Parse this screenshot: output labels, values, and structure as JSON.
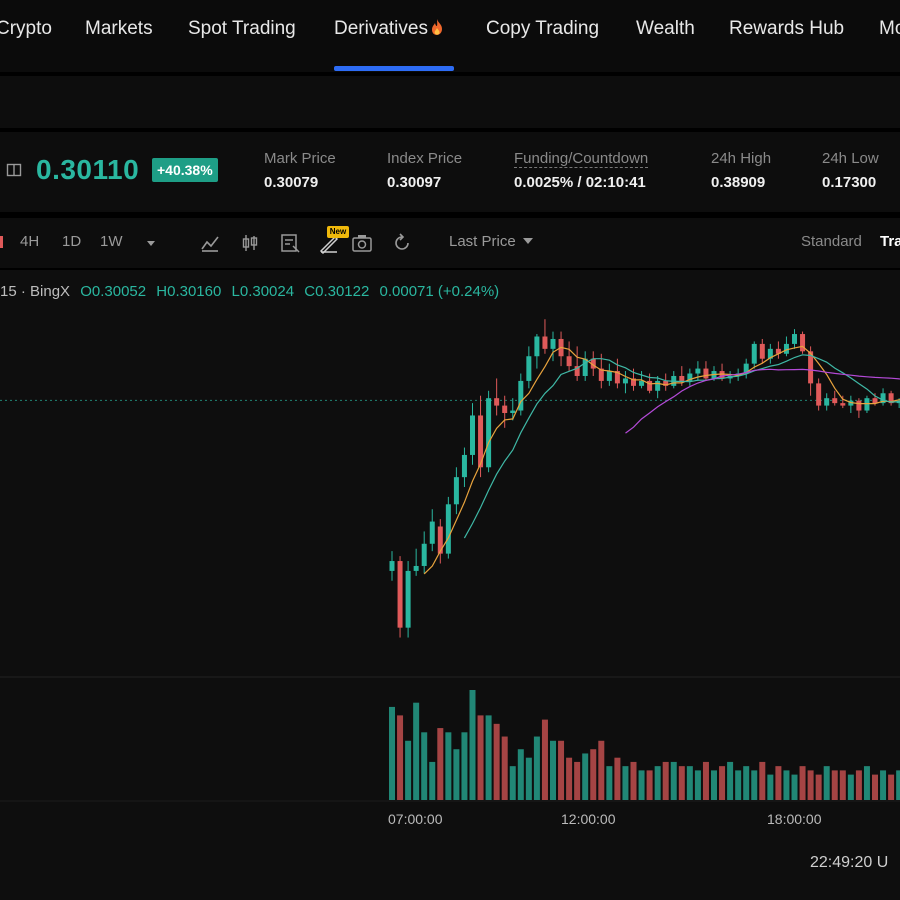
{
  "nav": {
    "items": [
      "Crypto",
      "Markets",
      "Spot Trading",
      "Derivatives",
      "Copy Trading",
      "Wealth",
      "Rewards Hub",
      "Mo"
    ],
    "active": "Derivatives"
  },
  "ticker": {
    "last_price": "0.30110",
    "change_pct": "+40.38%",
    "stats": [
      {
        "label": "Mark Price",
        "value": "0.30079"
      },
      {
        "label": "Index Price",
        "value": "0.30097"
      },
      {
        "label": "Funding/Countdown",
        "value": "0.0025% / 02:10:41"
      },
      {
        "label": "24h High",
        "value": "0.38909"
      },
      {
        "label": "24h Low",
        "value": "0.17300"
      }
    ]
  },
  "toolbar": {
    "timeframes": [
      "4H",
      "1D",
      "1W"
    ],
    "new_badge": "New",
    "price_type": "Last Price",
    "view_standard": "Standard",
    "view_trading": "Tra"
  },
  "ohlc_bar": {
    "symbol": "15 · BingX",
    "open": "O0.30052",
    "high": "H0.30160",
    "low": "L0.30024",
    "close": "C0.30122",
    "change": "0.00071 (+0.24%)"
  },
  "time_axis": [
    "07:00:00",
    "12:00:00",
    "18:00:00"
  ],
  "clock": "22:49:20 U",
  "colors": {
    "up": "#2ab7a0",
    "down": "#e05a5a",
    "accent": "#2d6cf5",
    "ma_fast": "#e8a33d",
    "ma_mid": "#3fb8a6",
    "ma_slow": "#b44ad8"
  },
  "icons": [
    "book-icon",
    "indicator-icon",
    "candle-type-icon",
    "template-icon",
    "draw-icon",
    "camera-icon",
    "refresh-icon",
    "caret-down-icon",
    "fire-icon"
  ],
  "chart_data": {
    "type": "candlestick",
    "ohlc": [
      [
        0.232,
        0.24,
        0.228,
        0.236
      ],
      [
        0.236,
        0.238,
        0.205,
        0.209
      ],
      [
        0.209,
        0.236,
        0.205,
        0.232
      ],
      [
        0.232,
        0.241,
        0.23,
        0.234
      ],
      [
        0.234,
        0.248,
        0.231,
        0.243
      ],
      [
        0.243,
        0.257,
        0.24,
        0.252
      ],
      [
        0.25,
        0.253,
        0.235,
        0.239
      ],
      [
        0.239,
        0.262,
        0.237,
        0.259
      ],
      [
        0.259,
        0.274,
        0.255,
        0.27
      ],
      [
        0.27,
        0.282,
        0.266,
        0.279
      ],
      [
        0.279,
        0.3,
        0.275,
        0.295
      ],
      [
        0.295,
        0.303,
        0.27,
        0.274
      ],
      [
        0.274,
        0.305,
        0.272,
        0.302
      ],
      [
        0.302,
        0.31,
        0.295,
        0.299
      ],
      [
        0.299,
        0.303,
        0.29,
        0.296
      ],
      [
        0.296,
        0.302,
        0.293,
        0.297
      ],
      [
        0.297,
        0.312,
        0.295,
        0.309
      ],
      [
        0.309,
        0.323,
        0.306,
        0.319
      ],
      [
        0.319,
        0.328,
        0.314,
        0.327
      ],
      [
        0.327,
        0.334,
        0.32,
        0.322
      ],
      [
        0.322,
        0.329,
        0.317,
        0.326
      ],
      [
        0.326,
        0.329,
        0.315,
        0.319
      ],
      [
        0.319,
        0.325,
        0.313,
        0.315
      ],
      [
        0.315,
        0.323,
        0.309,
        0.311
      ],
      [
        0.311,
        0.321,
        0.309,
        0.318
      ],
      [
        0.318,
        0.321,
        0.311,
        0.314
      ],
      [
        0.314,
        0.32,
        0.306,
        0.309
      ],
      [
        0.309,
        0.316,
        0.307,
        0.313
      ],
      [
        0.313,
        0.318,
        0.306,
        0.308
      ],
      [
        0.308,
        0.313,
        0.304,
        0.31
      ],
      [
        0.31,
        0.314,
        0.305,
        0.307
      ],
      [
        0.307,
        0.313,
        0.306,
        0.309
      ],
      [
        0.309,
        0.312,
        0.304,
        0.305
      ],
      [
        0.305,
        0.311,
        0.302,
        0.309
      ],
      [
        0.309,
        0.312,
        0.305,
        0.307
      ],
      [
        0.307,
        0.313,
        0.306,
        0.311
      ],
      [
        0.311,
        0.315,
        0.307,
        0.309
      ],
      [
        0.309,
        0.314,
        0.307,
        0.312
      ],
      [
        0.312,
        0.317,
        0.309,
        0.314
      ],
      [
        0.314,
        0.317,
        0.309,
        0.31
      ],
      [
        0.31,
        0.315,
        0.309,
        0.313
      ],
      [
        0.313,
        0.316,
        0.309,
        0.31
      ],
      [
        0.31,
        0.313,
        0.308,
        0.311
      ],
      [
        0.311,
        0.314,
        0.309,
        0.312
      ],
      [
        0.312,
        0.318,
        0.31,
        0.316
      ],
      [
        0.316,
        0.325,
        0.314,
        0.324
      ],
      [
        0.324,
        0.326,
        0.316,
        0.318
      ],
      [
        0.318,
        0.324,
        0.316,
        0.322
      ],
      [
        0.322,
        0.325,
        0.318,
        0.32
      ],
      [
        0.32,
        0.327,
        0.319,
        0.324
      ],
      [
        0.324,
        0.33,
        0.322,
        0.328
      ],
      [
        0.328,
        0.329,
        0.32,
        0.321
      ],
      [
        0.321,
        0.323,
        0.303,
        0.308
      ],
      [
        0.308,
        0.31,
        0.297,
        0.299
      ],
      [
        0.299,
        0.304,
        0.297,
        0.302
      ],
      [
        0.302,
        0.305,
        0.299,
        0.3
      ],
      [
        0.3,
        0.303,
        0.298,
        0.299
      ],
      [
        0.299,
        0.303,
        0.296,
        0.301
      ],
      [
        0.301,
        0.302,
        0.294,
        0.297
      ],
      [
        0.297,
        0.303,
        0.296,
        0.302
      ],
      [
        0.302,
        0.304,
        0.299,
        0.3
      ],
      [
        0.3,
        0.306,
        0.299,
        0.304
      ],
      [
        0.304,
        0.305,
        0.299,
        0.3
      ],
      [
        0.3,
        0.302,
        0.298,
        0.301
      ],
      [
        0.301,
        0.303,
        0.299,
        0.3
      ]
    ],
    "volume": [
      22,
      20,
      14,
      23,
      16,
      9,
      17,
      16,
      12,
      16,
      26,
      20,
      20,
      18,
      15,
      8,
      12,
      10,
      15,
      19,
      14,
      14,
      10,
      9,
      11,
      12,
      14,
      8,
      10,
      8,
      9,
      7,
      7,
      8,
      9,
      9,
      8,
      8,
      7,
      9,
      7,
      8,
      9,
      7,
      8,
      7,
      9,
      6,
      8,
      7,
      6,
      8,
      7,
      6,
      8,
      7,
      7,
      6,
      7,
      8,
      6,
      7,
      6,
      7,
      6
    ],
    "ma_series": [
      "fast",
      "mid",
      "slow"
    ],
    "x_ticks": [
      "07:00:00",
      "12:00:00",
      "18:00:00"
    ]
  }
}
